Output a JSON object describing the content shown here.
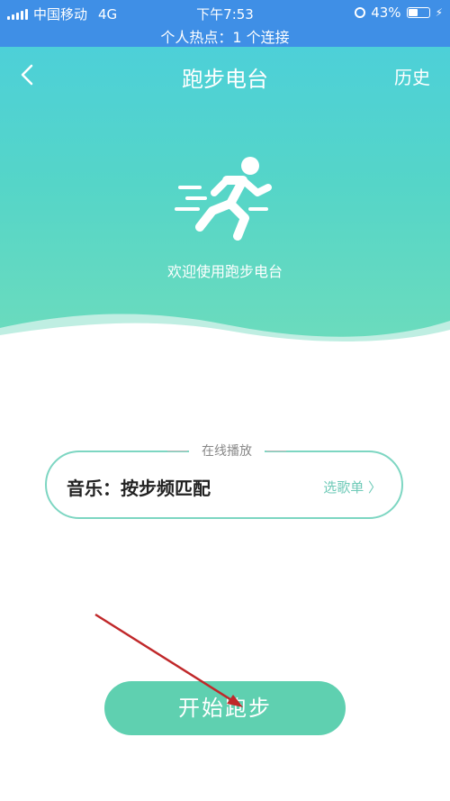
{
  "status_bar": {
    "carrier": "中国移动",
    "network": "4G",
    "time": "下午7:53",
    "battery": "43%",
    "hotspot": "个人热点：1 个连接"
  },
  "nav": {
    "title": "跑步电台",
    "history": "历史"
  },
  "hero": {
    "welcome": "欢迎使用跑步电台",
    "icon": "running-person-icon"
  },
  "online": {
    "label": "在线播放",
    "music": "音乐：按步频匹配",
    "select": "选歌单 〉"
  },
  "start_button": "开始跑步",
  "colors": {
    "statusbar": "#3f8fe6",
    "hero_top": "#4dd0d8",
    "hero_bottom": "#6ddcbc",
    "accent": "#5fd0b0",
    "arrow": "#c0282a"
  }
}
